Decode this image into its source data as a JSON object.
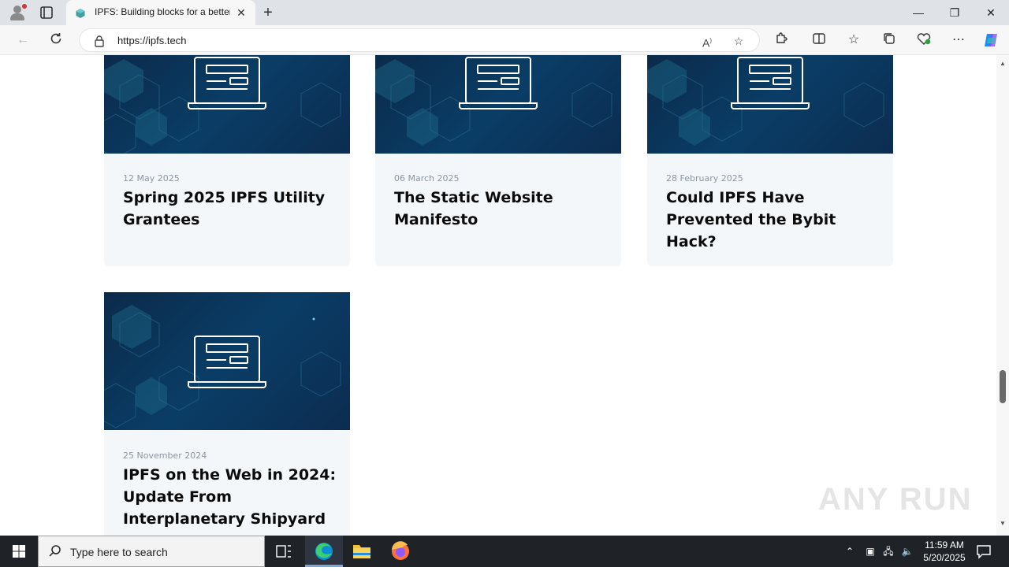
{
  "browser": {
    "tab_title": "IPFS: Building blocks for a better",
    "url": "https://ipfs.tech",
    "new_tab_symbol": "+",
    "close_tab_symbol": "✕",
    "window_controls": {
      "minimize": "—",
      "maximize": "❐",
      "close": "✕"
    },
    "address_icons": [
      "read-aloud-icon",
      "favorite-star-icon"
    ],
    "toolbar_icons": [
      "extensions-icon",
      "split-screen-icon",
      "favorites-icon",
      "collections-icon",
      "browser-essentials-icon",
      "more-icon",
      "copilot-icon"
    ]
  },
  "posts": [
    {
      "date": "12 May 2025",
      "title": "Spring 2025 IPFS Utility Grantees"
    },
    {
      "date": "06 March 2025",
      "title": "The Static Website Manifesto"
    },
    {
      "date": "28 February 2025",
      "title": "Could IPFS Have Prevented the Bybit Hack?"
    },
    {
      "date": "25 November 2024",
      "title": "IPFS on the Web in 2024: Update From Interplanetary Shipyard"
    }
  ],
  "watermark": "ANY RUN",
  "taskbar": {
    "search_placeholder": "Type here to search",
    "apps": [
      "task-view-icon",
      "edge-icon",
      "file-explorer-icon",
      "firefox-icon"
    ],
    "clock_time": "11:59 AM",
    "clock_date": "5/20/2025"
  },
  "colors": {
    "thumb_bg": "#0a3d66",
    "card_bg": "#f3f7fa",
    "taskbar": "#1f2328",
    "accent": "#0078d4"
  }
}
